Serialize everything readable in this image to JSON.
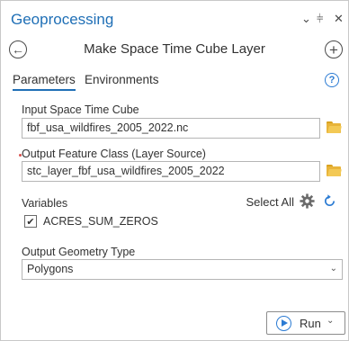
{
  "pane": {
    "title": "Geoprocessing",
    "controls": {
      "menu": "⌄",
      "pin": "⫩",
      "close": "✕"
    }
  },
  "tool": {
    "title": "Make Space Time Cube Layer",
    "back_icon": "←",
    "add_icon": "+"
  },
  "tabs": [
    {
      "label": "Parameters",
      "active": true
    },
    {
      "label": "Environments",
      "active": false
    }
  ],
  "help_icon": "?",
  "params": {
    "input_cube": {
      "label": "Input Space Time Cube",
      "value": "fbf_usa_wildfires_2005_2022.nc"
    },
    "output_fc": {
      "label": "Output Feature Class (Layer Source)",
      "value": "stc_layer_fbf_usa_wildfires_2005_2022"
    },
    "variables": {
      "label": "Variables",
      "select_all": "Select All",
      "items": [
        {
          "label": "ACRES_SUM_ZEROS",
          "checked": true,
          "check_glyph": "✔"
        }
      ]
    },
    "geometry": {
      "label": "Output Geometry Type",
      "value": "Polygons",
      "arrow": "⌄"
    }
  },
  "run": {
    "label": "Run",
    "arrow": "⌄"
  },
  "colors": {
    "accent": "#1f6fb6",
    "folder": "#e8b43a",
    "run_icon": "#2b7bd3"
  }
}
